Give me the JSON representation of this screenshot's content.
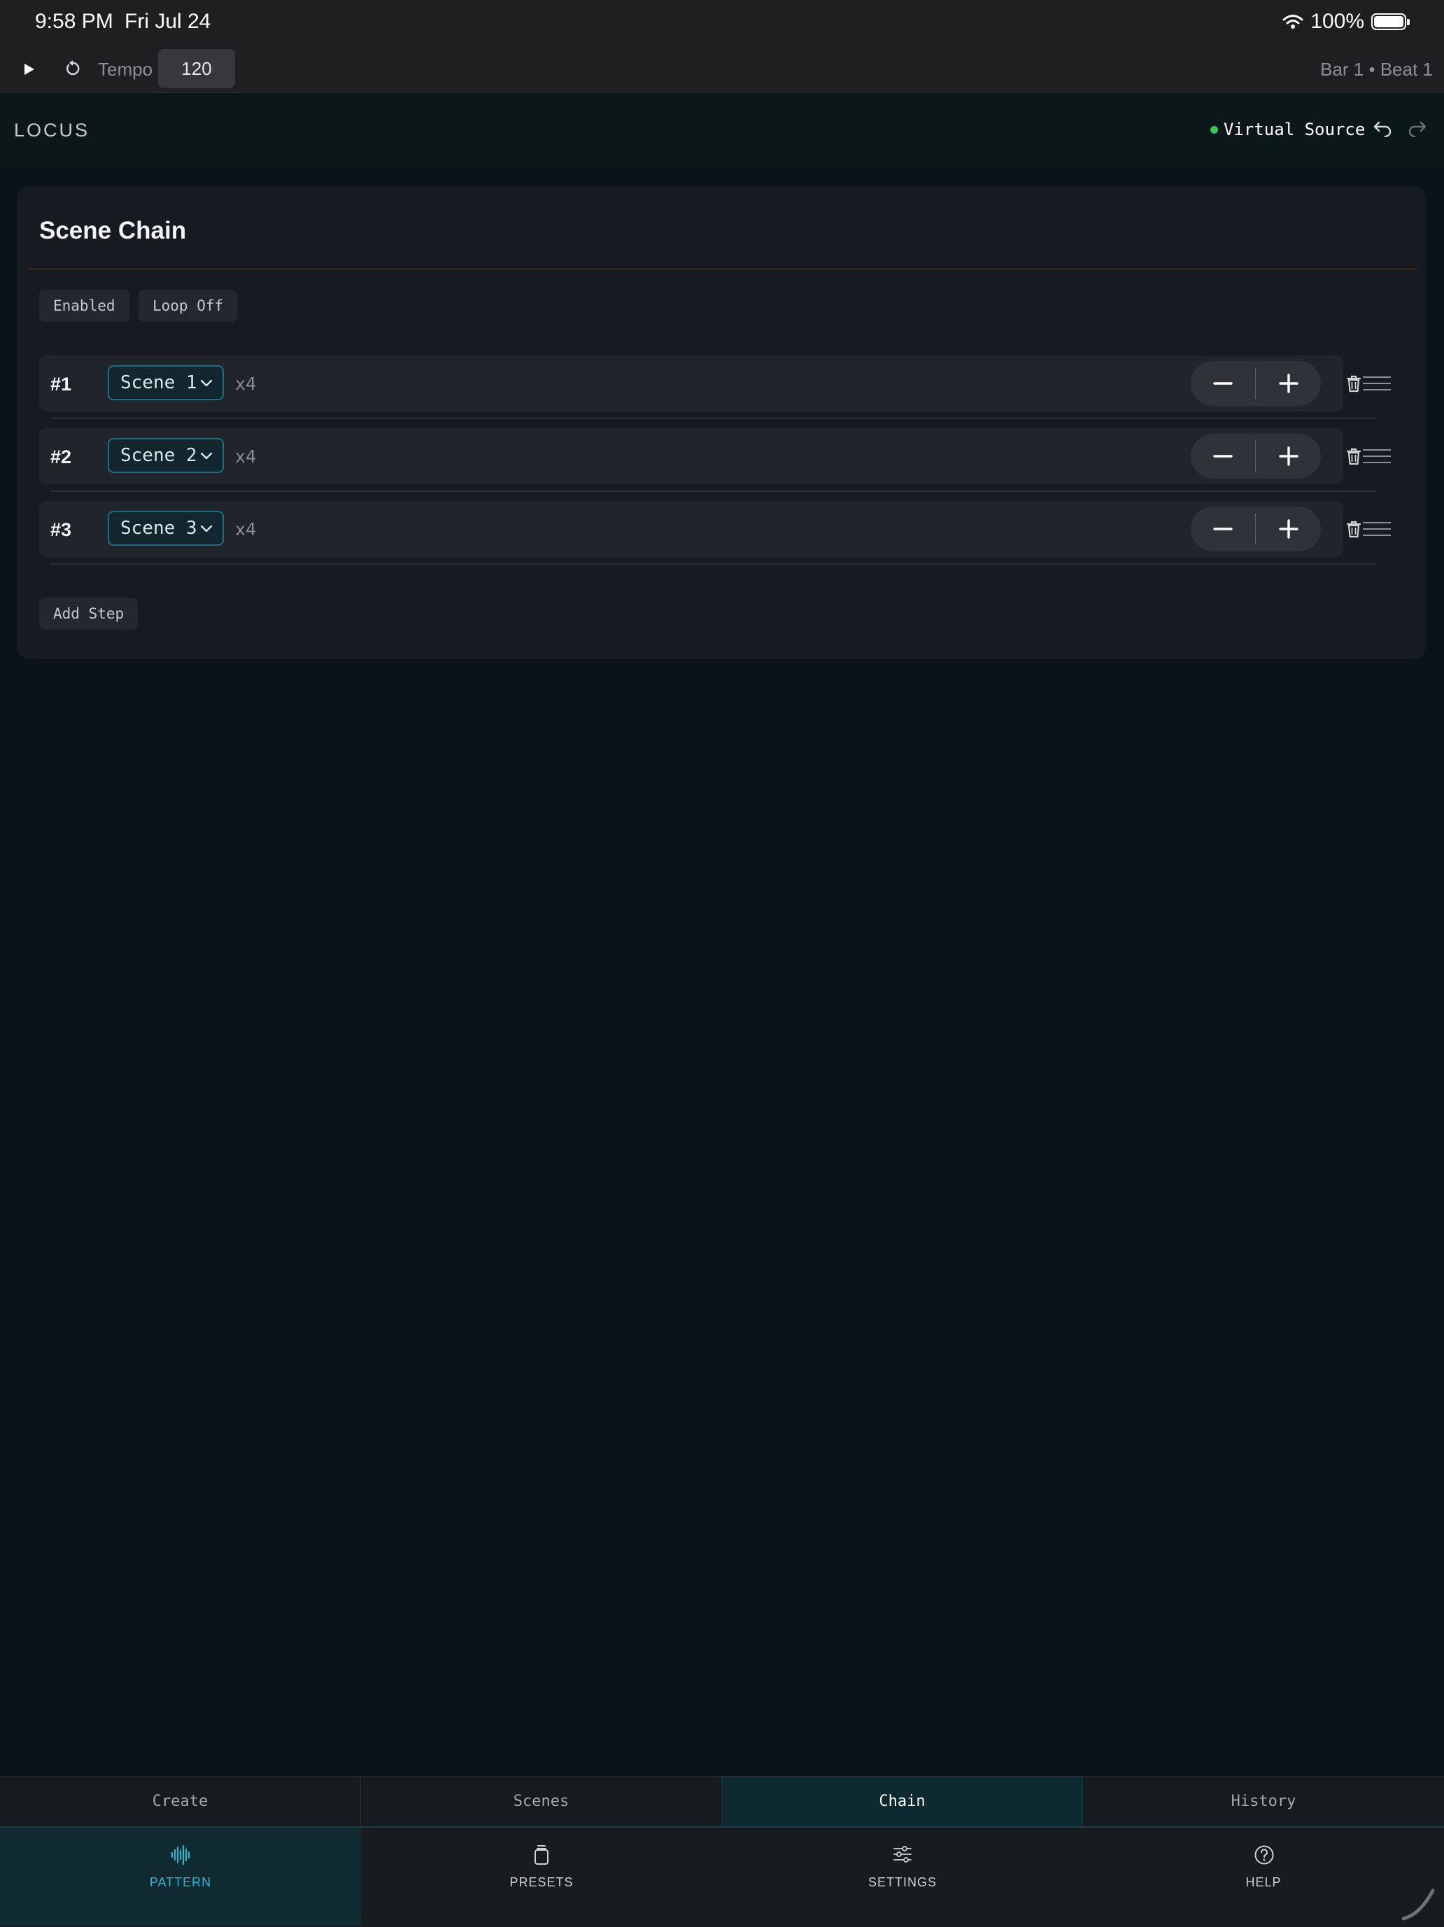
{
  "status_bar": {
    "time": "9:58 PM",
    "date": "Fri Jul 24",
    "battery": "100%"
  },
  "transport": {
    "tempo_label": "Tempo",
    "tempo_value": "120",
    "position": "Bar 1 • Beat 1"
  },
  "app": {
    "title": "LOCUS",
    "source_name": "Virtual Source",
    "source_status_color": "#34c759"
  },
  "chain_panel": {
    "title": "Scene Chain",
    "enabled_label": "Enabled",
    "loop_label": "Loop Off",
    "steps": [
      {
        "number": "#1",
        "scene": "Scene 1",
        "repeat": "x4"
      },
      {
        "number": "#2",
        "scene": "Scene 2",
        "repeat": "x4"
      },
      {
        "number": "#3",
        "scene": "Scene 3",
        "repeat": "x4"
      }
    ],
    "add_step_label": "Add Step"
  },
  "tabs": [
    {
      "label": "Create",
      "active": false
    },
    {
      "label": "Scenes",
      "active": false
    },
    {
      "label": "Chain",
      "active": true
    },
    {
      "label": "History",
      "active": false
    }
  ],
  "bottom_nav": [
    {
      "label": "PATTERN",
      "icon": "waveform-icon",
      "active": true
    },
    {
      "label": "PRESETS",
      "icon": "jar-icon",
      "active": false
    },
    {
      "label": "SETTINGS",
      "icon": "sliders-icon",
      "active": false
    },
    {
      "label": "HELP",
      "icon": "question-circle-icon",
      "active": false
    }
  ],
  "colors": {
    "accent": "#2fb3cf",
    "background": "#0a1418",
    "panel": "#151b20"
  }
}
